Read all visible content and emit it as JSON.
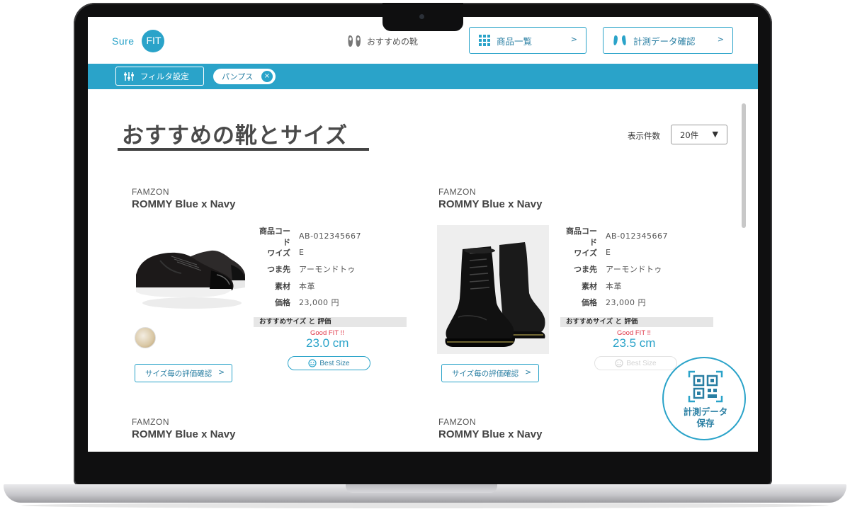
{
  "header": {
    "logo_text": "Sure",
    "logo_badge": "FIT",
    "recommend_link": "おすすめの靴",
    "nav_list": "商品一覧",
    "nav_measure": "計測データ確認",
    "chevron": ">"
  },
  "filter": {
    "button_label": "フィルタ設定",
    "chip_label": "パンプス",
    "chip_remove": "×"
  },
  "main": {
    "title": "おすすめの靴とサイズ",
    "count_label": "表示件数",
    "count_value": "20件",
    "count_arrow": "▼"
  },
  "labels": {
    "code": "商品コード",
    "width": "ワイズ",
    "toe": "つま先",
    "material": "素材",
    "price": "価格",
    "rec_head": "おすすめサイズ と 評価",
    "good_fit": "Good FIT !!",
    "best_size": "Best Size",
    "size_eval": "サイズ毎の評価確認",
    "chevron": ">"
  },
  "products": [
    {
      "brand": "FAMZON",
      "name": "ROMMY Blue x Navy",
      "code": "AB-012345667",
      "width": "E",
      "toe": "アーモンドトゥ",
      "material": "本革",
      "price": "23,000 円",
      "size": "23.0 cm"
    },
    {
      "brand": "FAMZON",
      "name": "ROMMY Blue x Navy",
      "code": "AB-012345667",
      "width": "E",
      "toe": "アーモンドトゥ",
      "material": "本革",
      "price": "23,000 円",
      "size": "23.5 cm"
    },
    {
      "brand": "FAMZON",
      "name": "ROMMY Blue x Navy"
    },
    {
      "brand": "FAMZON",
      "name": "ROMMY Blue x Navy"
    }
  ],
  "fab": {
    "line1": "計測データ",
    "line2": "保存"
  },
  "colors": {
    "accent": "#2aa3c9",
    "accent_dark": "#2a7fa3",
    "good_fit": "#e0394a"
  }
}
